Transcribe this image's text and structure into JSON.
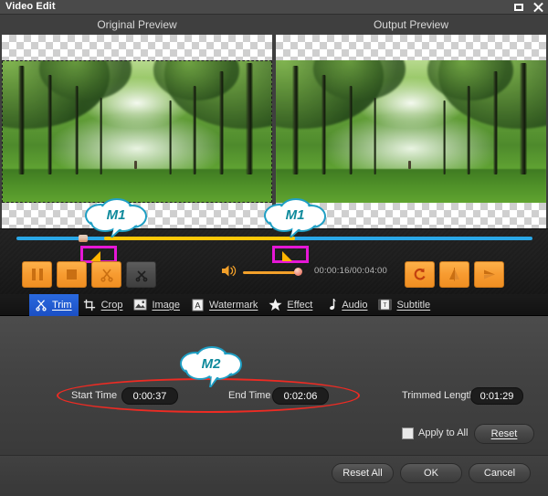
{
  "window": {
    "title": "Video Edit",
    "buttons": [
      {
        "name": "maximize-button",
        "icon": "maximize-icon"
      },
      {
        "name": "close-button",
        "icon": "close-icon"
      }
    ]
  },
  "previews": {
    "original_label": "Original Preview",
    "output_label": "Output Preview"
  },
  "player": {
    "timecode": "00:00:16/00:04:00",
    "volume_icon": "speaker-icon",
    "volume_percent": 90,
    "timeline": {
      "selection_start_percent": 17,
      "selection_end_percent": 54
    },
    "transport": [
      {
        "name": "pause-button",
        "icon": "pause-icon",
        "enabled": true
      },
      {
        "name": "stop-button",
        "icon": "stop-icon",
        "enabled": true
      },
      {
        "name": "cut-button",
        "icon": "scissors-icon",
        "enabled": true
      },
      {
        "name": "split-button",
        "icon": "scissors-disabled-icon",
        "enabled": false
      }
    ],
    "transform": [
      {
        "name": "rotate-button",
        "icon": "rotate-icon"
      },
      {
        "name": "flip-vertical-button",
        "icon": "flip-vertical-icon"
      },
      {
        "name": "flip-horizontal-button",
        "icon": "flip-horizontal-icon"
      }
    ],
    "trim_handles": [
      {
        "name": "trim-start-handle",
        "highlighted": true
      },
      {
        "name": "trim-end-handle",
        "highlighted": true
      }
    ]
  },
  "tabs": [
    {
      "label": "Trim",
      "icon": "scissors-icon",
      "active": true
    },
    {
      "label": "Crop",
      "icon": "crop-icon",
      "active": false
    },
    {
      "label": "Image",
      "icon": "image-icon",
      "active": false
    },
    {
      "label": "Watermark",
      "icon": "text-a-icon",
      "active": false
    },
    {
      "label": "Effect",
      "icon": "star-icon",
      "active": false
    },
    {
      "label": "Audio",
      "icon": "music-note-icon",
      "active": false
    },
    {
      "label": "Subtitle",
      "icon": "subtitle-icon",
      "active": false
    }
  ],
  "trim_panel": {
    "start_time_label": "Start Time",
    "start_time_value": "0:00:37",
    "end_time_label": "End Time",
    "end_time_value": "0:02:06",
    "trimmed_length_label": "Trimmed Length",
    "trimmed_length_value": "0:01:29",
    "apply_to_all_label": "Apply to All",
    "apply_to_all_checked": false,
    "reset_label": "Reset"
  },
  "footer": {
    "reset_all_label": "Reset All",
    "ok_label": "OK",
    "cancel_label": "Cancel"
  },
  "annotations": [
    {
      "id": "m1-left",
      "text": "M1"
    },
    {
      "id": "m1-right",
      "text": "M1"
    },
    {
      "id": "m2",
      "text": "M2"
    }
  ],
  "colors": {
    "accent_blue": "#2aa8e8",
    "accent_yellow": "#ffc808",
    "highlight_magenta": "#e617d6",
    "highlight_red": "#ee2b23",
    "tab_active_blue": "#1b4fc4",
    "button_orange": "#f79b30",
    "callout_teal": "#0f8a9c"
  }
}
